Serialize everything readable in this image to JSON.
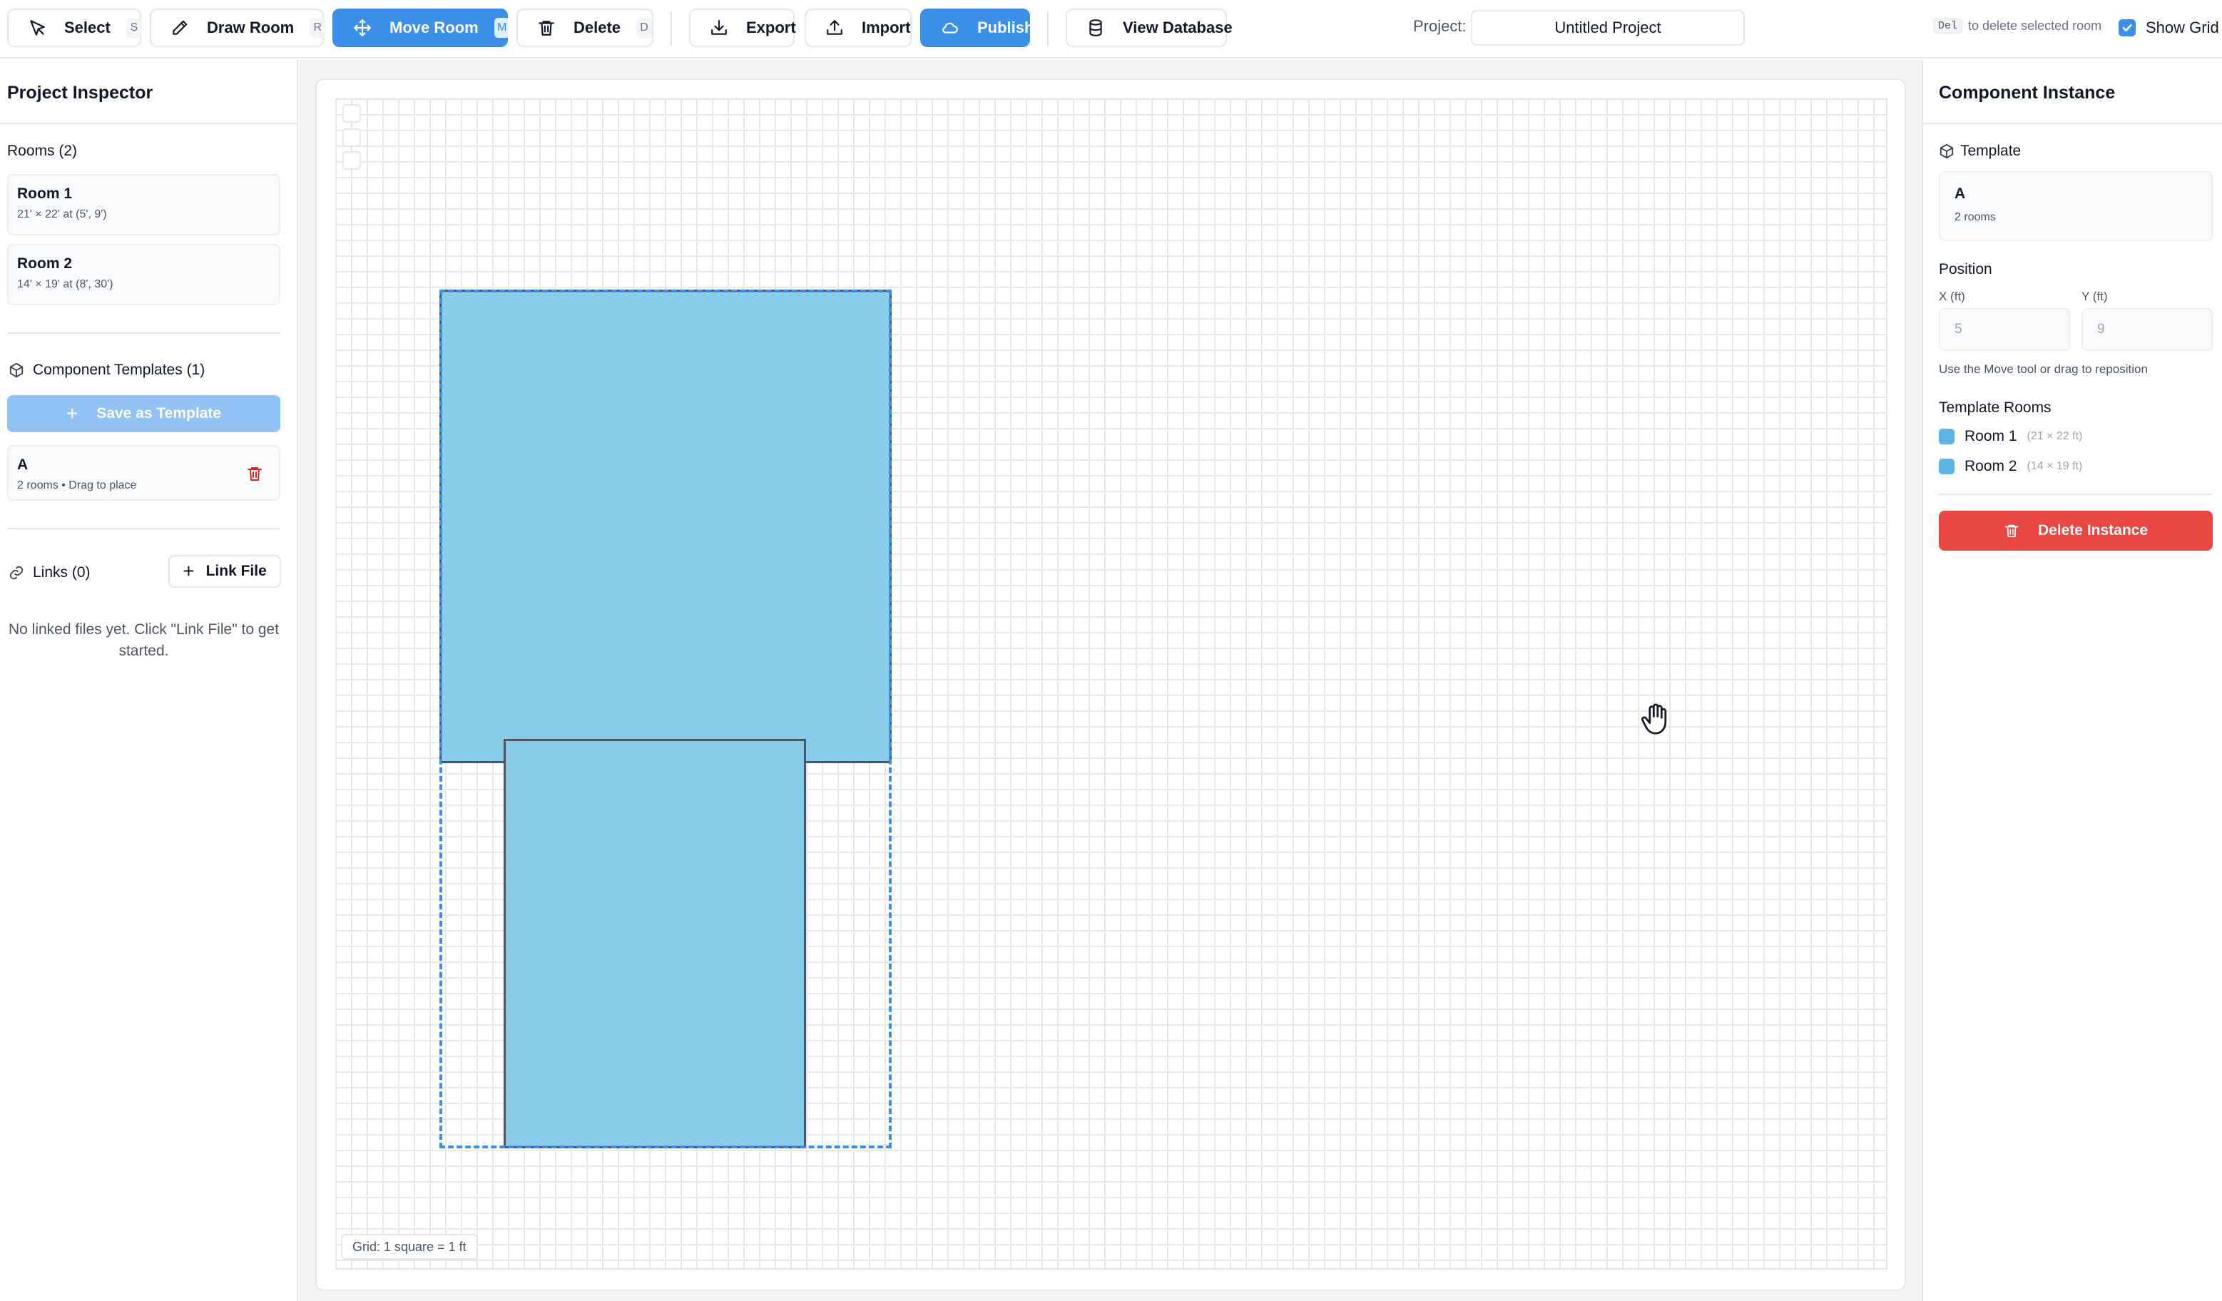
{
  "toolbar": {
    "tools": [
      {
        "label": "Select",
        "shortcut": "S"
      },
      {
        "label": "Draw Room",
        "shortcut": "R"
      },
      {
        "label": "Move Room",
        "shortcut": "M"
      },
      {
        "label": "Delete",
        "shortcut": "D"
      }
    ],
    "active_tool": "Move Room",
    "export_label": "Export",
    "import_label": "Import",
    "publish_label": "Publish",
    "view_db_label": "View Database",
    "project_label": "Project:",
    "project_name": "Untitled Project",
    "hint_key": "Del",
    "hint_text": "to delete selected room",
    "show_grid_label": "Show Grid",
    "show_grid_checked": true
  },
  "left": {
    "title": "Project Inspector",
    "rooms_header": "Rooms (2)",
    "rooms": [
      {
        "name": "Room 1",
        "detail": "21' × 22' at (5', 9')"
      },
      {
        "name": "Room 2",
        "detail": "14' × 19' at (8', 30')"
      }
    ],
    "templates_header": "Component Templates (1)",
    "save_template_label": "Save as Template",
    "templates": [
      {
        "name": "A",
        "detail": "2 rooms • Drag to place"
      }
    ],
    "links_header": "Links (0)",
    "link_file_label": "Link File",
    "links_empty": "No linked files yet. Click \"Link File\" to get started."
  },
  "canvas": {
    "grid_label": "Grid: 1 square = 1 ft",
    "room_color": "#89ccea",
    "selection_color": "#3b8fe8"
  },
  "right": {
    "title": "Component Instance",
    "template_label": "Template",
    "template_name": "A",
    "template_rooms_count": "2 rooms",
    "position_label": "Position",
    "x_label": "X (ft)",
    "y_label": "Y (ft)",
    "x_value": "5",
    "y_value": "9",
    "position_help": "Use the Move tool or drag to reposition",
    "template_rooms_label": "Template Rooms",
    "template_rooms": [
      {
        "name": "Room 1",
        "dims": "(21 × 22 ft)"
      },
      {
        "name": "Room 2",
        "dims": "(14 × 19 ft)"
      }
    ],
    "delete_label": "Delete Instance",
    "delete_color": "#ea4744"
  }
}
